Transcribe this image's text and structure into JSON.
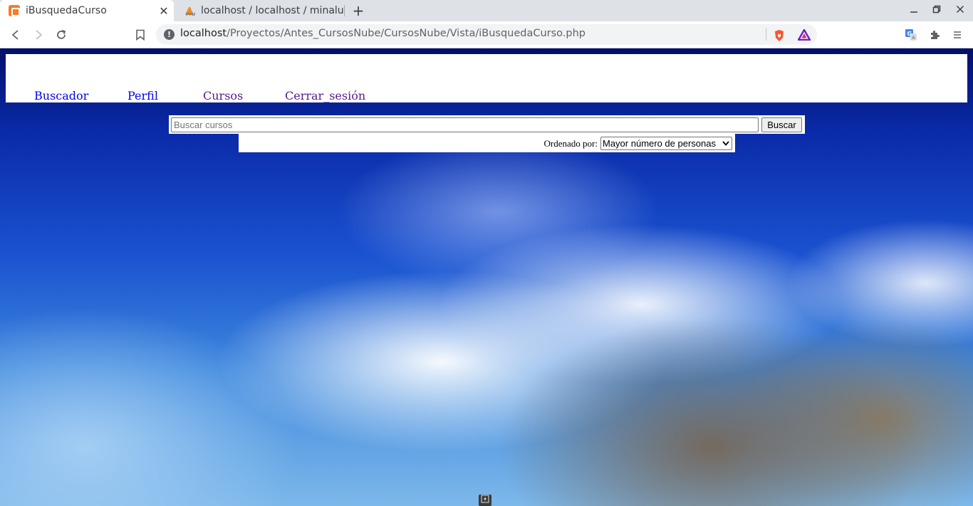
{
  "browser": {
    "tabs": [
      {
        "title": "iBusquedaCurso",
        "icon": "xampp-favicon",
        "active": true
      },
      {
        "title": "localhost / localhost / minalum",
        "icon": "phpmyadmin-favicon",
        "active": false
      }
    ],
    "address_bar": {
      "host": "localhost",
      "path": "/Proyectos/Antes_CursosNube/CursosNube/Vista/iBusquedaCurso.php"
    }
  },
  "page": {
    "nav": {
      "items": [
        {
          "label": "Buscador",
          "state": "unvisited"
        },
        {
          "label": "Perfil",
          "state": "unvisited"
        },
        {
          "label": "Cursos",
          "state": "visited"
        },
        {
          "label": "Cerrar_sesión",
          "state": "visited"
        }
      ]
    },
    "search": {
      "placeholder": "Buscar cursos",
      "value": "",
      "button_label": "Buscar"
    },
    "sort": {
      "label": "Ordenado por:",
      "selected": "Mayor número de personas"
    }
  },
  "colors": {
    "link_unvisited": "#0000ee",
    "link_visited": "#551a8b",
    "background_sky": "#0a2aa8"
  }
}
